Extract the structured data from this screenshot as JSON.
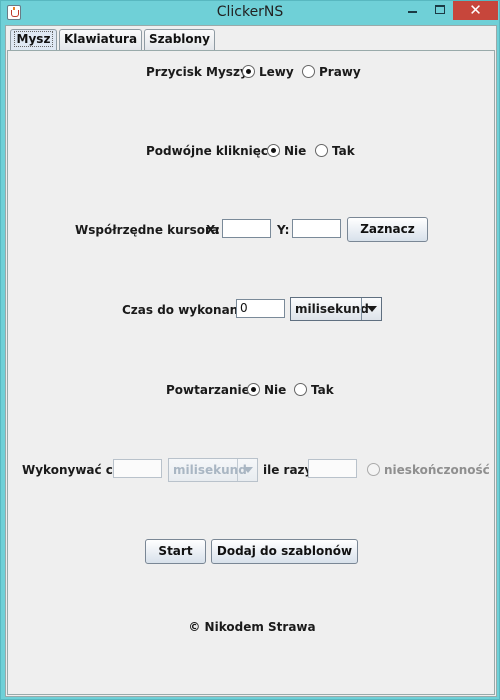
{
  "window": {
    "title": "ClickerNS"
  },
  "tabs": [
    {
      "label": "Mysz"
    },
    {
      "label": "Klawiatura"
    },
    {
      "label": "Szablony"
    }
  ],
  "mouse_button": {
    "label": "Przycisk Myszy",
    "options": [
      "Lewy",
      "Prawy"
    ],
    "selected": "Lewy"
  },
  "double_click": {
    "label": "Podwójne kliknięcie",
    "options": [
      "Nie",
      "Tak"
    ],
    "selected": "Nie"
  },
  "coords": {
    "label": "Współrzędne kursora",
    "x_label": "X:",
    "x_value": "",
    "y_label": "Y:",
    "y_value": "",
    "button": "Zaznacz"
  },
  "delay": {
    "label": "Czas do wykonania",
    "value": "0",
    "unit": "milisekund"
  },
  "repeat": {
    "label": "Powtarzanie",
    "options": [
      "Nie",
      "Tak"
    ],
    "selected": "Nie"
  },
  "interval": {
    "label": "Wykonywać co",
    "value": "",
    "unit": "milisekund",
    "count_label": "ile razy",
    "count_value": "",
    "infinite_label": "nieskończoność"
  },
  "actions": {
    "start": "Start",
    "add_template": "Dodaj do szablonów"
  },
  "footer": {
    "copyright": "© Nikodem Strawa"
  },
  "colors": {
    "title_bar": "#6fd0d7",
    "close_button": "#c7463b",
    "panel_bg": "#efefef"
  },
  "icons": {
    "app": "java-cup-icon",
    "minimize": "minimize-icon",
    "maximize": "maximize-icon",
    "close": "close-icon"
  }
}
